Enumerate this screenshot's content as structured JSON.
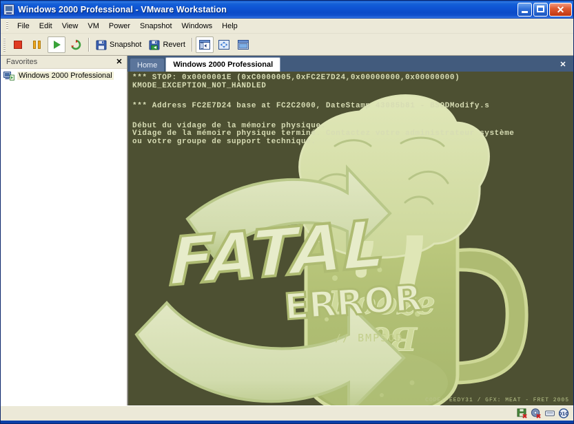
{
  "window": {
    "title": "Windows 2000 Professional - VMware Workstation",
    "icon": "vmware-vm-icon",
    "minimize_label": "Minimize",
    "maximize_label": "Maximize",
    "close_label": "✕"
  },
  "menubar": {
    "items": [
      {
        "label": "File"
      },
      {
        "label": "Edit"
      },
      {
        "label": "View"
      },
      {
        "label": "VM"
      },
      {
        "label": "Power"
      },
      {
        "label": "Snapshot"
      },
      {
        "label": "Windows"
      },
      {
        "label": "Help"
      }
    ]
  },
  "toolbar": {
    "stop_label": "",
    "pause_label": "",
    "play_label": "",
    "reset_label": "",
    "snapshot_label": "Snapshot",
    "revert_label": "Revert",
    "sidebar_label": "",
    "fullscreen_label": "",
    "quickswitch_label": ""
  },
  "sidebar": {
    "title": "Favorites",
    "close_label": "✕",
    "items": [
      {
        "label": "Windows 2000 Professional",
        "icon": "vm-powered-icon"
      }
    ]
  },
  "tabs": [
    {
      "label": "Home",
      "active": false
    },
    {
      "label": "Windows 2000 Professional",
      "active": true
    }
  ],
  "tabstrip": {
    "close_label": "✕"
  },
  "bsod": {
    "background_color": "#4d5032",
    "text_color": "#d7dcb4",
    "line1": "*** STOP: 0x0000001E (0xC0000005,0xFC2E7D24,0x00000000,0x00000000)",
    "line2": "KMODE_EXCEPTION_NOT_HANDLED",
    "line3": "*** Address FC2E7D24 base at FC2C2000, DateStamp 43085b81 - BSODModify.s",
    "line4": "Début du vidage de la mémoire physique.",
    "line5": "Vidage de la mémoire physique terminé. Contactez votre administrateur système",
    "line6": "ou votre groupe de support technique.",
    "art_title": "FATAL",
    "art_subtitle": "ERROR",
    "art_tag": "// BMPSOD",
    "mug_label_top": "Booze",
    "mug_label_bottom": "Bob",
    "credits": "CODE: EEDY31 / GFX: MEAT - FRET 2005"
  },
  "statusbar": {
    "icons": [
      {
        "name": "floppy-disconnected-icon"
      },
      {
        "name": "cdrom-disconnected-icon"
      },
      {
        "name": "network-icon"
      },
      {
        "name": "usb-icon"
      }
    ]
  }
}
